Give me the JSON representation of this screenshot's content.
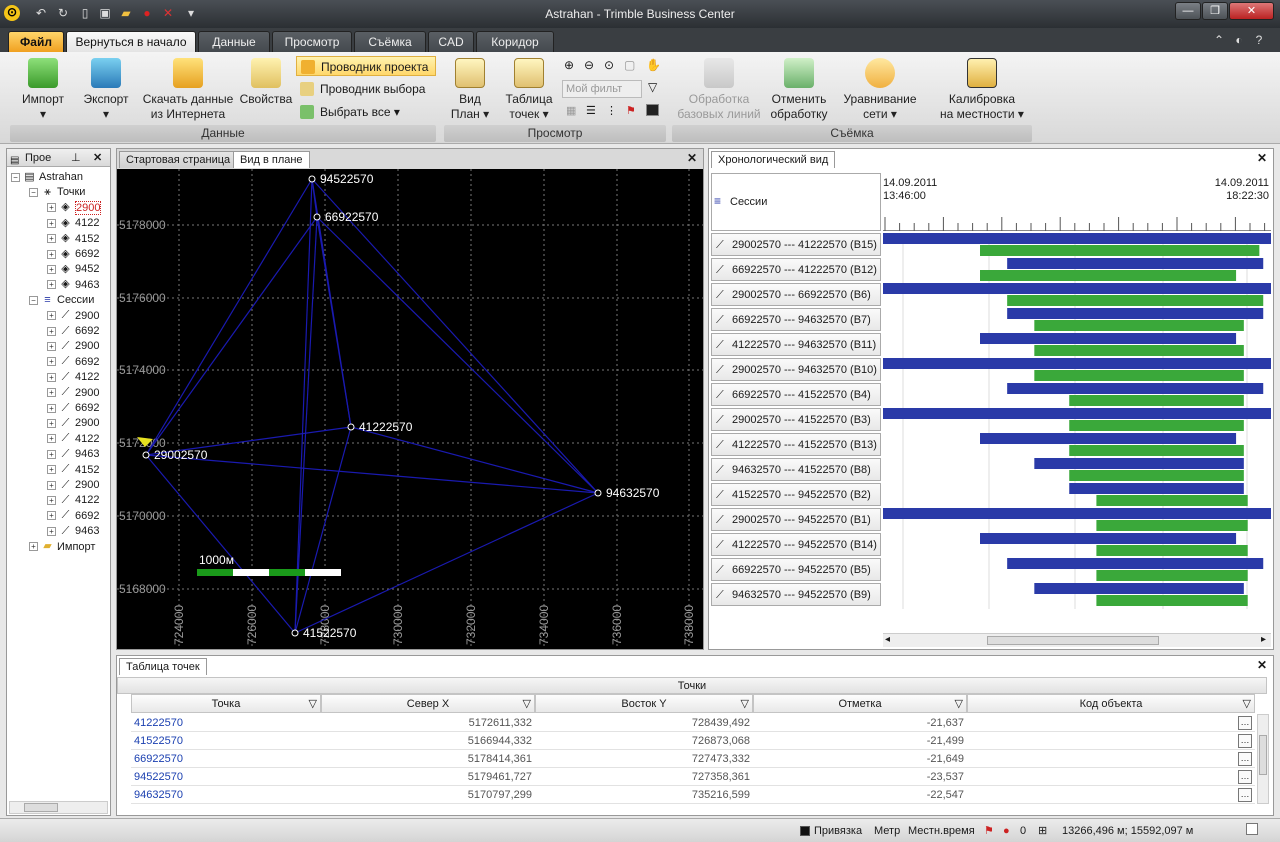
{
  "window": {
    "title": "Astrahan - Trimble Business Center"
  },
  "quick_access": {
    "icons": [
      "app-logo-icon",
      "undo-icon",
      "redo-icon",
      "new-icon",
      "save-icon",
      "open-icon",
      "record-icon",
      "cancel-icon"
    ]
  },
  "ribbon_tabs": [
    "Файл",
    "Вернуться в начало",
    "Данные",
    "Просмотр",
    "Съёмка",
    "CAD",
    "Коридор"
  ],
  "ribbon": {
    "data_group": {
      "label": "Данные",
      "import": "Импорт",
      "export": "Экспорт",
      "download_line1": "Скачать данные",
      "download_line2": "из Интернета",
      "properties": "Свойства",
      "project_explorer": "Проводник проекта",
      "selection_explorer": "Проводник выбора",
      "select_all": "Выбрать все"
    },
    "view_group": {
      "label": "Просмотр",
      "plan_view_line1": "Вид",
      "plan_view_line2": "План",
      "points_table_line1": "Таблица",
      "points_table_line2": "точек",
      "filter_placeholder": "Мой фильт"
    },
    "survey_group": {
      "label": "Съёмка",
      "process_line1": "Обработка",
      "process_line2": "базовых линий",
      "undo_process_line1": "Отменить",
      "undo_process_line2": "обработку",
      "adjust_line1": "Уравнивание",
      "adjust_line2": "сети",
      "calib_line1": "Калибровка",
      "calib_line2": "на местности"
    }
  },
  "project_panel": {
    "title": "Прое",
    "root": "Astrahan",
    "points_label": "Точки",
    "points": [
      "2900",
      "4122",
      "4152",
      "6692",
      "9452",
      "9463"
    ],
    "sessions_label": "Сессии",
    "sessions": [
      "2900",
      "6692",
      "2900",
      "6692",
      "4122",
      "2900",
      "6692",
      "2900",
      "4122",
      "9463",
      "4152",
      "2900",
      "4122",
      "6692",
      "9463"
    ],
    "import_label": "Импорт"
  },
  "plan_view": {
    "tabs": [
      "Стартовая страница",
      "Вид в плане"
    ],
    "y_ticks": [
      "5178000",
      "5176000",
      "5174000",
      "5172000",
      "5170000",
      "5168000"
    ],
    "x_ticks": [
      "724000",
      "726000",
      "728000",
      "730000",
      "732000",
      "734000",
      "736000",
      "738000"
    ],
    "scale_label": "1000м",
    "points": [
      {
        "name": "94522570"
      },
      {
        "name": "66922570"
      },
      {
        "name": "41222570"
      },
      {
        "name": "29002570"
      },
      {
        "name": "94632570"
      },
      {
        "name": "41522570"
      }
    ]
  },
  "chrono_view": {
    "tab": "Хронологический вид",
    "header_label": "Сессии",
    "start_date": "14.09.2011",
    "start_time": "13:46:00",
    "end_date": "14.09.2011",
    "end_time": "18:22:30",
    "rows": [
      {
        "label": "29002570 --- 41222570 (B15)",
        "blue": [
          0.0,
          1.0
        ],
        "green": [
          0.25,
          0.97
        ]
      },
      {
        "label": "66922570 --- 41222570 (B12)",
        "blue": [
          0.32,
          0.98
        ],
        "green": [
          0.25,
          0.91
        ]
      },
      {
        "label": "29002570 --- 66922570 (B6)",
        "blue": [
          0.0,
          1.0
        ],
        "green": [
          0.32,
          0.98
        ]
      },
      {
        "label": "66922570 --- 94632570 (B7)",
        "blue": [
          0.32,
          0.98
        ],
        "green": [
          0.39,
          0.93
        ]
      },
      {
        "label": "41222570 --- 94632570 (B11)",
        "blue": [
          0.25,
          0.91
        ],
        "green": [
          0.39,
          0.93
        ]
      },
      {
        "label": "29002570 --- 94632570 (B10)",
        "blue": [
          0.0,
          1.0
        ],
        "green": [
          0.39,
          0.93
        ]
      },
      {
        "label": "66922570 --- 41522570 (B4)",
        "blue": [
          0.32,
          0.98
        ],
        "green": [
          0.48,
          0.93
        ]
      },
      {
        "label": "29002570 --- 41522570 (B3)",
        "blue": [
          0.0,
          1.0
        ],
        "green": [
          0.48,
          0.93
        ]
      },
      {
        "label": "41222570 --- 41522570 (B13)",
        "blue": [
          0.25,
          0.91
        ],
        "green": [
          0.48,
          0.93
        ]
      },
      {
        "label": "94632570 --- 41522570 (B8)",
        "blue": [
          0.39,
          0.93
        ],
        "green": [
          0.48,
          0.93
        ]
      },
      {
        "label": "41522570 --- 94522570 (B2)",
        "blue": [
          0.48,
          0.93
        ],
        "green": [
          0.55,
          0.94
        ]
      },
      {
        "label": "29002570 --- 94522570 (B1)",
        "blue": [
          0.0,
          1.0
        ],
        "green": [
          0.55,
          0.94
        ]
      },
      {
        "label": "41222570 --- 94522570 (B14)",
        "blue": [
          0.25,
          0.91
        ],
        "green": [
          0.55,
          0.94
        ]
      },
      {
        "label": "66922570 --- 94522570 (B5)",
        "blue": [
          0.32,
          0.98
        ],
        "green": [
          0.55,
          0.94
        ]
      },
      {
        "label": "94632570 --- 94522570 (B9)",
        "blue": [
          0.39,
          0.93
        ],
        "green": [
          0.55,
          0.94
        ]
      }
    ]
  },
  "points_table": {
    "tab": "Таблица точек",
    "group_header": "Точки",
    "columns": [
      "Точка",
      "Север X",
      "Восток Y",
      "Отметка",
      "Код объекта"
    ],
    "rows": [
      [
        "41222570",
        "5172611,332",
        "728439,492",
        "-21,637",
        ""
      ],
      [
        "41522570",
        "5166944,332",
        "726873,068",
        "-21,499",
        ""
      ],
      [
        "66922570",
        "5178414,361",
        "727473,332",
        "-21,649",
        ""
      ],
      [
        "94522570",
        "5179461,727",
        "727358,361",
        "-23,537",
        ""
      ],
      [
        "94632570",
        "5170797,299",
        "735216,599",
        "-22,547",
        ""
      ]
    ]
  },
  "status_bar": {
    "snap": "Привязка",
    "units": "Метр",
    "time": "Местн.время",
    "count": "0",
    "coords": "13266,496 м; 15592,097 м"
  },
  "colors": {
    "blue_bar": "#2a3aa8",
    "green_bar": "#3aa83a",
    "network_line": "#1a1ab0"
  }
}
